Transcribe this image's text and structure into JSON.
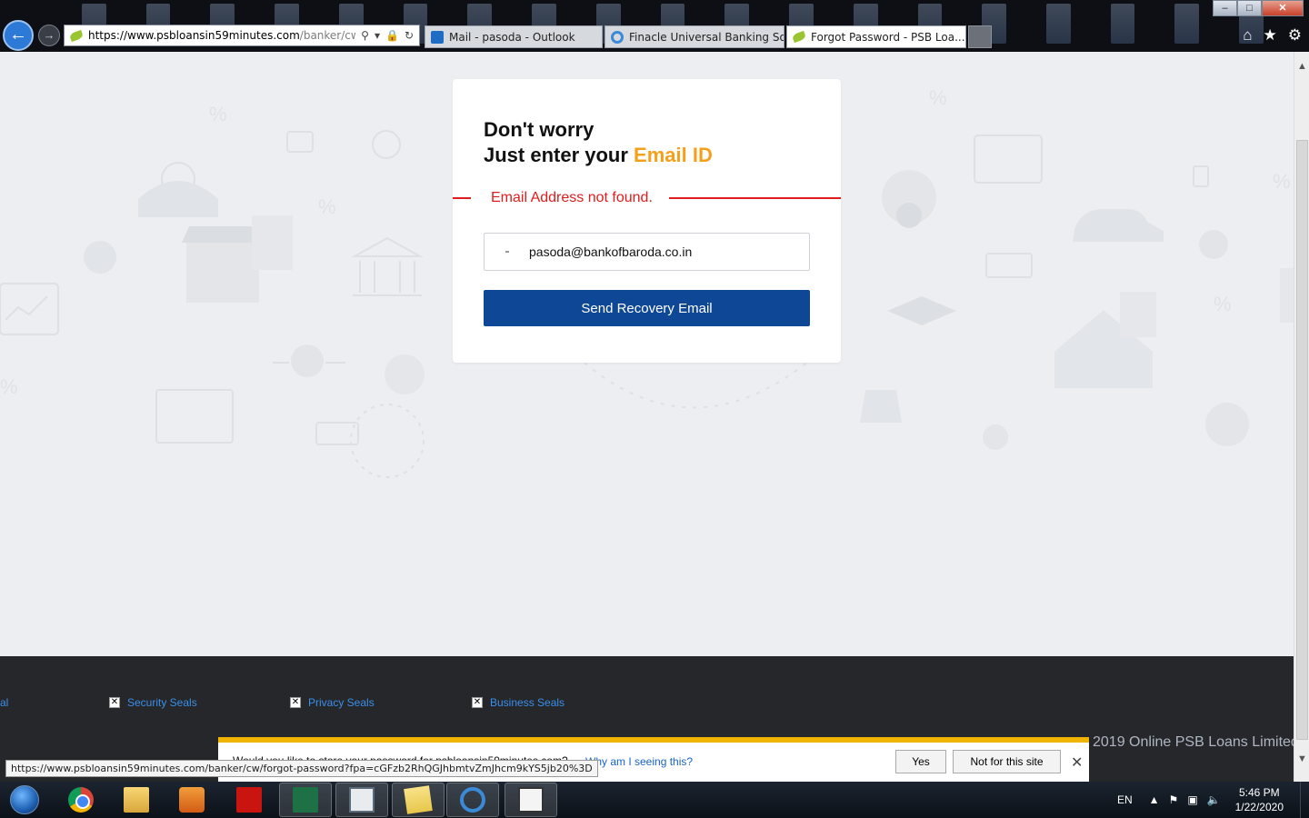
{
  "browser": {
    "address_prefix": "https://www.",
    "address_host": "psbloansin59minutes.com",
    "address_path": "/banker/cw/forg",
    "tabs": [
      {
        "label": "Mail - pasoda - Outlook",
        "icon": "outlook-icon"
      },
      {
        "label": "Finacle Universal Banking Solu...",
        "icon": "ie-icon"
      },
      {
        "label": "Forgot Password - PSB Loa...",
        "icon": "psb-leaf-icon",
        "active": true
      }
    ],
    "window_buttons": {
      "minimize": "–",
      "restore": "□",
      "close": "✕"
    }
  },
  "form": {
    "heading_line1": "Don't worry",
    "heading_line2_prefix": "Just enter your ",
    "heading_line2_accent": "Email ID",
    "error_message": "Email Address not found.",
    "email_value": "pasoda@bankofbaroda.co.in",
    "submit_label": "Send Recovery Email"
  },
  "footer": {
    "partial_left": "al",
    "seals": [
      "Security Seals",
      "Privacy Seals",
      "Business Seals"
    ],
    "copyright": "2019 Online PSB Loans Limited"
  },
  "notification": {
    "question": "Would you like to store your password for psbloansin59minutes.com?",
    "why_link": "Why am I seeing this?",
    "yes_label": "Yes",
    "no_label": "Not for this site"
  },
  "status_url": "https://www.psbloansin59minutes.com/banker/cw/forgot-password?fpa=cGFzb2RhQGJhbmtvZmJhcm9kYS5jb20%3D",
  "taskbar": {
    "apps": [
      "chrome-icon",
      "file-explorer-icon",
      "media-player-icon",
      "acrobat-icon",
      "excel-icon",
      "document-window-icon",
      "sticky-notes-icon",
      "internet-explorer-icon",
      "app-window-icon"
    ],
    "language": "EN",
    "time": "5:46 PM",
    "date": "1/22/2020"
  },
  "colors": {
    "accent": "#f5a01a",
    "error": "#e01c1c",
    "primary_button": "#0d4795",
    "footer_bg": "#25272b",
    "link": "#3b8fe8"
  }
}
